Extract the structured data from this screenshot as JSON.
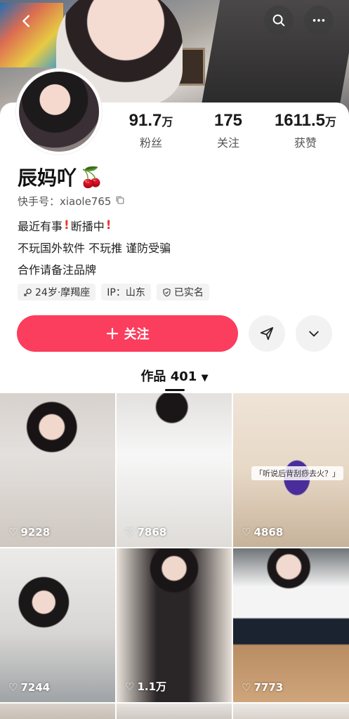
{
  "header": {
    "back_icon": "chevron-left-icon",
    "search_icon": "search-icon",
    "more_icon": "more-horizontal-icon"
  },
  "profile": {
    "nickname": "辰妈吖",
    "nickname_emoji": "🍒",
    "uid_label": "快手号：xiaole765",
    "stats": [
      {
        "value": "91.7",
        "unit": "万",
        "label": "粉丝"
      },
      {
        "value": "175",
        "unit": "",
        "label": "关注"
      },
      {
        "value": "1611.5",
        "unit": "万",
        "label": "获赞"
      }
    ],
    "bio": {
      "line1_a": "最近有事",
      "line1_b": "断播中",
      "line2": "不玩国外软件 不玩推  谨防受骗",
      "line3": "合作请备注品牌"
    },
    "tags": [
      {
        "icon": "gender-icon",
        "text": "24岁·摩羯座"
      },
      {
        "icon": "",
        "text": "IP：山东"
      },
      {
        "icon": "verified-shield-icon",
        "text": "已实名"
      }
    ]
  },
  "actions": {
    "follow_label": "关注",
    "share_icon": "send-icon",
    "expand_icon": "chevron-down-icon"
  },
  "works": {
    "tab_label": "作品 401",
    "items": [
      {
        "likes": "9228",
        "caption": ""
      },
      {
        "likes": "7868",
        "caption": ""
      },
      {
        "likes": "4868",
        "caption": "「听说后背刮痧去火？」"
      },
      {
        "likes": "7244",
        "caption": ""
      },
      {
        "likes": "1.1万",
        "caption": ""
      },
      {
        "likes": "7773",
        "caption": ""
      }
    ]
  },
  "colors": {
    "accent": "#fb3d5e",
    "bang": "#e53935"
  }
}
